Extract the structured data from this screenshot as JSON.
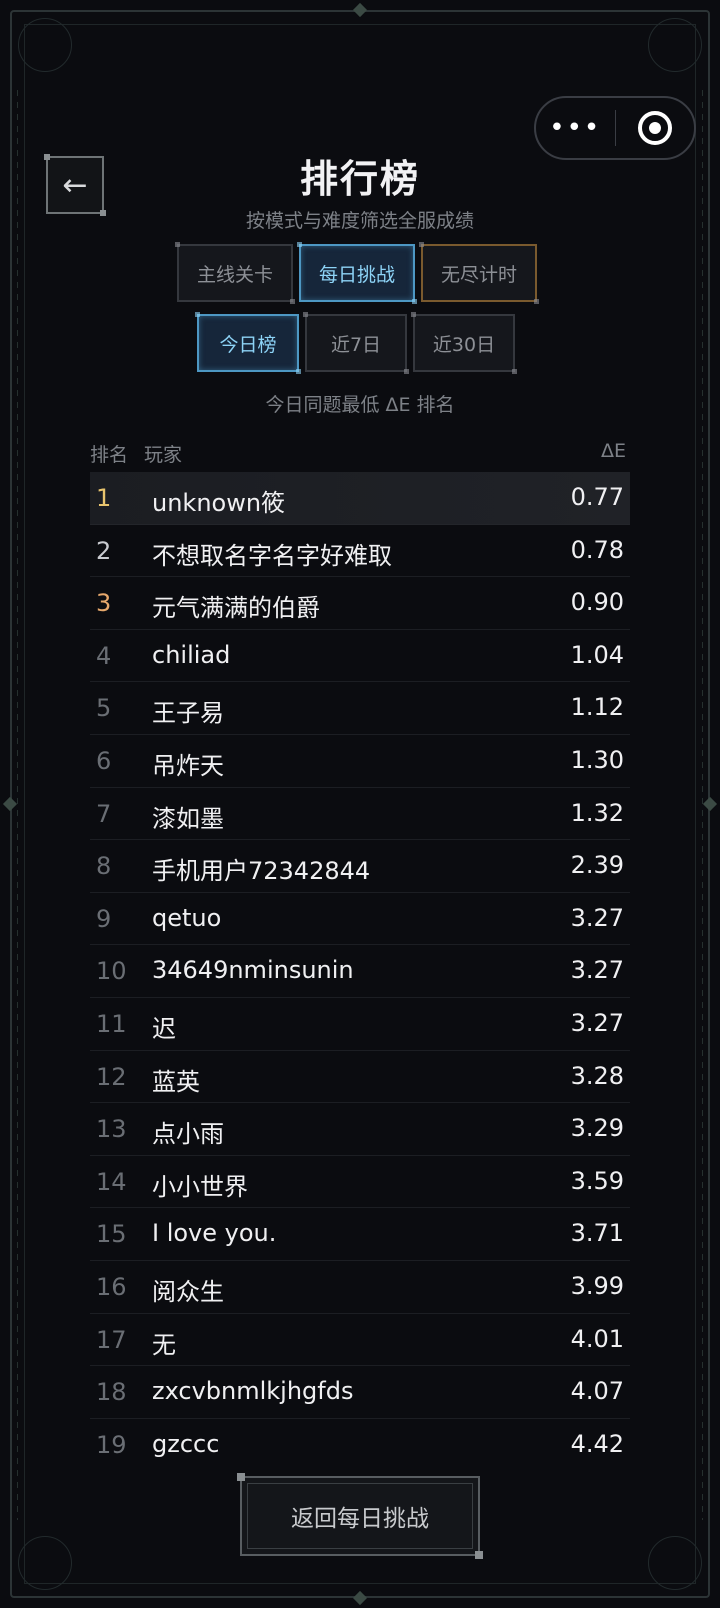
{
  "header": {
    "title": "排行榜",
    "subtitle": "按模式与难度筛选全服成绩",
    "back_icon": "←"
  },
  "capsule": {
    "more_icon": "•••",
    "close_icon": "target-icon"
  },
  "mode_tabs": [
    {
      "label": "主线关卡",
      "active": false
    },
    {
      "label": "每日挑战",
      "active": true
    },
    {
      "label": "无尽计时",
      "active": false
    }
  ],
  "period_tabs": [
    {
      "label": "今日榜",
      "active": true
    },
    {
      "label": "近7日",
      "active": false
    },
    {
      "label": "近30日",
      "active": false
    }
  ],
  "hint": "今日同题最低 ΔE 排名",
  "table": {
    "col_rank": "排名",
    "col_player": "玩家",
    "col_delta": "ΔE",
    "rows": [
      {
        "rank": "1",
        "name": "unknown筱",
        "value": "0.77"
      },
      {
        "rank": "2",
        "name": "不想取名字名字好难取",
        "value": "0.78"
      },
      {
        "rank": "3",
        "name": "元气满满的伯爵",
        "value": "0.90"
      },
      {
        "rank": "4",
        "name": "chiliad",
        "value": "1.04"
      },
      {
        "rank": "5",
        "name": "王子易",
        "value": "1.12"
      },
      {
        "rank": "6",
        "name": "吊炸天",
        "value": "1.30"
      },
      {
        "rank": "7",
        "name": "漆如墨",
        "value": "1.32"
      },
      {
        "rank": "8",
        "name": "手机用户72342844",
        "value": "2.39"
      },
      {
        "rank": "9",
        "name": "qetuo",
        "value": "3.27"
      },
      {
        "rank": "10",
        "name": "34649nminsunin",
        "value": "3.27"
      },
      {
        "rank": "11",
        "name": "迟",
        "value": "3.27"
      },
      {
        "rank": "12",
        "name": "蓝英",
        "value": "3.28"
      },
      {
        "rank": "13",
        "name": "点小雨",
        "value": "3.29"
      },
      {
        "rank": "14",
        "name": "小小世界",
        "value": "3.59"
      },
      {
        "rank": "15",
        "name": "I love you.",
        "value": "3.71"
      },
      {
        "rank": "16",
        "name": "阅众生",
        "value": "3.99"
      },
      {
        "rank": "17",
        "name": "无",
        "value": "4.01"
      },
      {
        "rank": "18",
        "name": "zxcvbnmlkjhgfds",
        "value": "4.07"
      },
      {
        "rank": "19",
        "name": "gzccc",
        "value": "4.42"
      }
    ]
  },
  "return_button": "返回每日挑战",
  "colors": {
    "accent_active": "#8dd3f6",
    "gold": "#e8c46e",
    "bronze": "#e6a86c"
  }
}
